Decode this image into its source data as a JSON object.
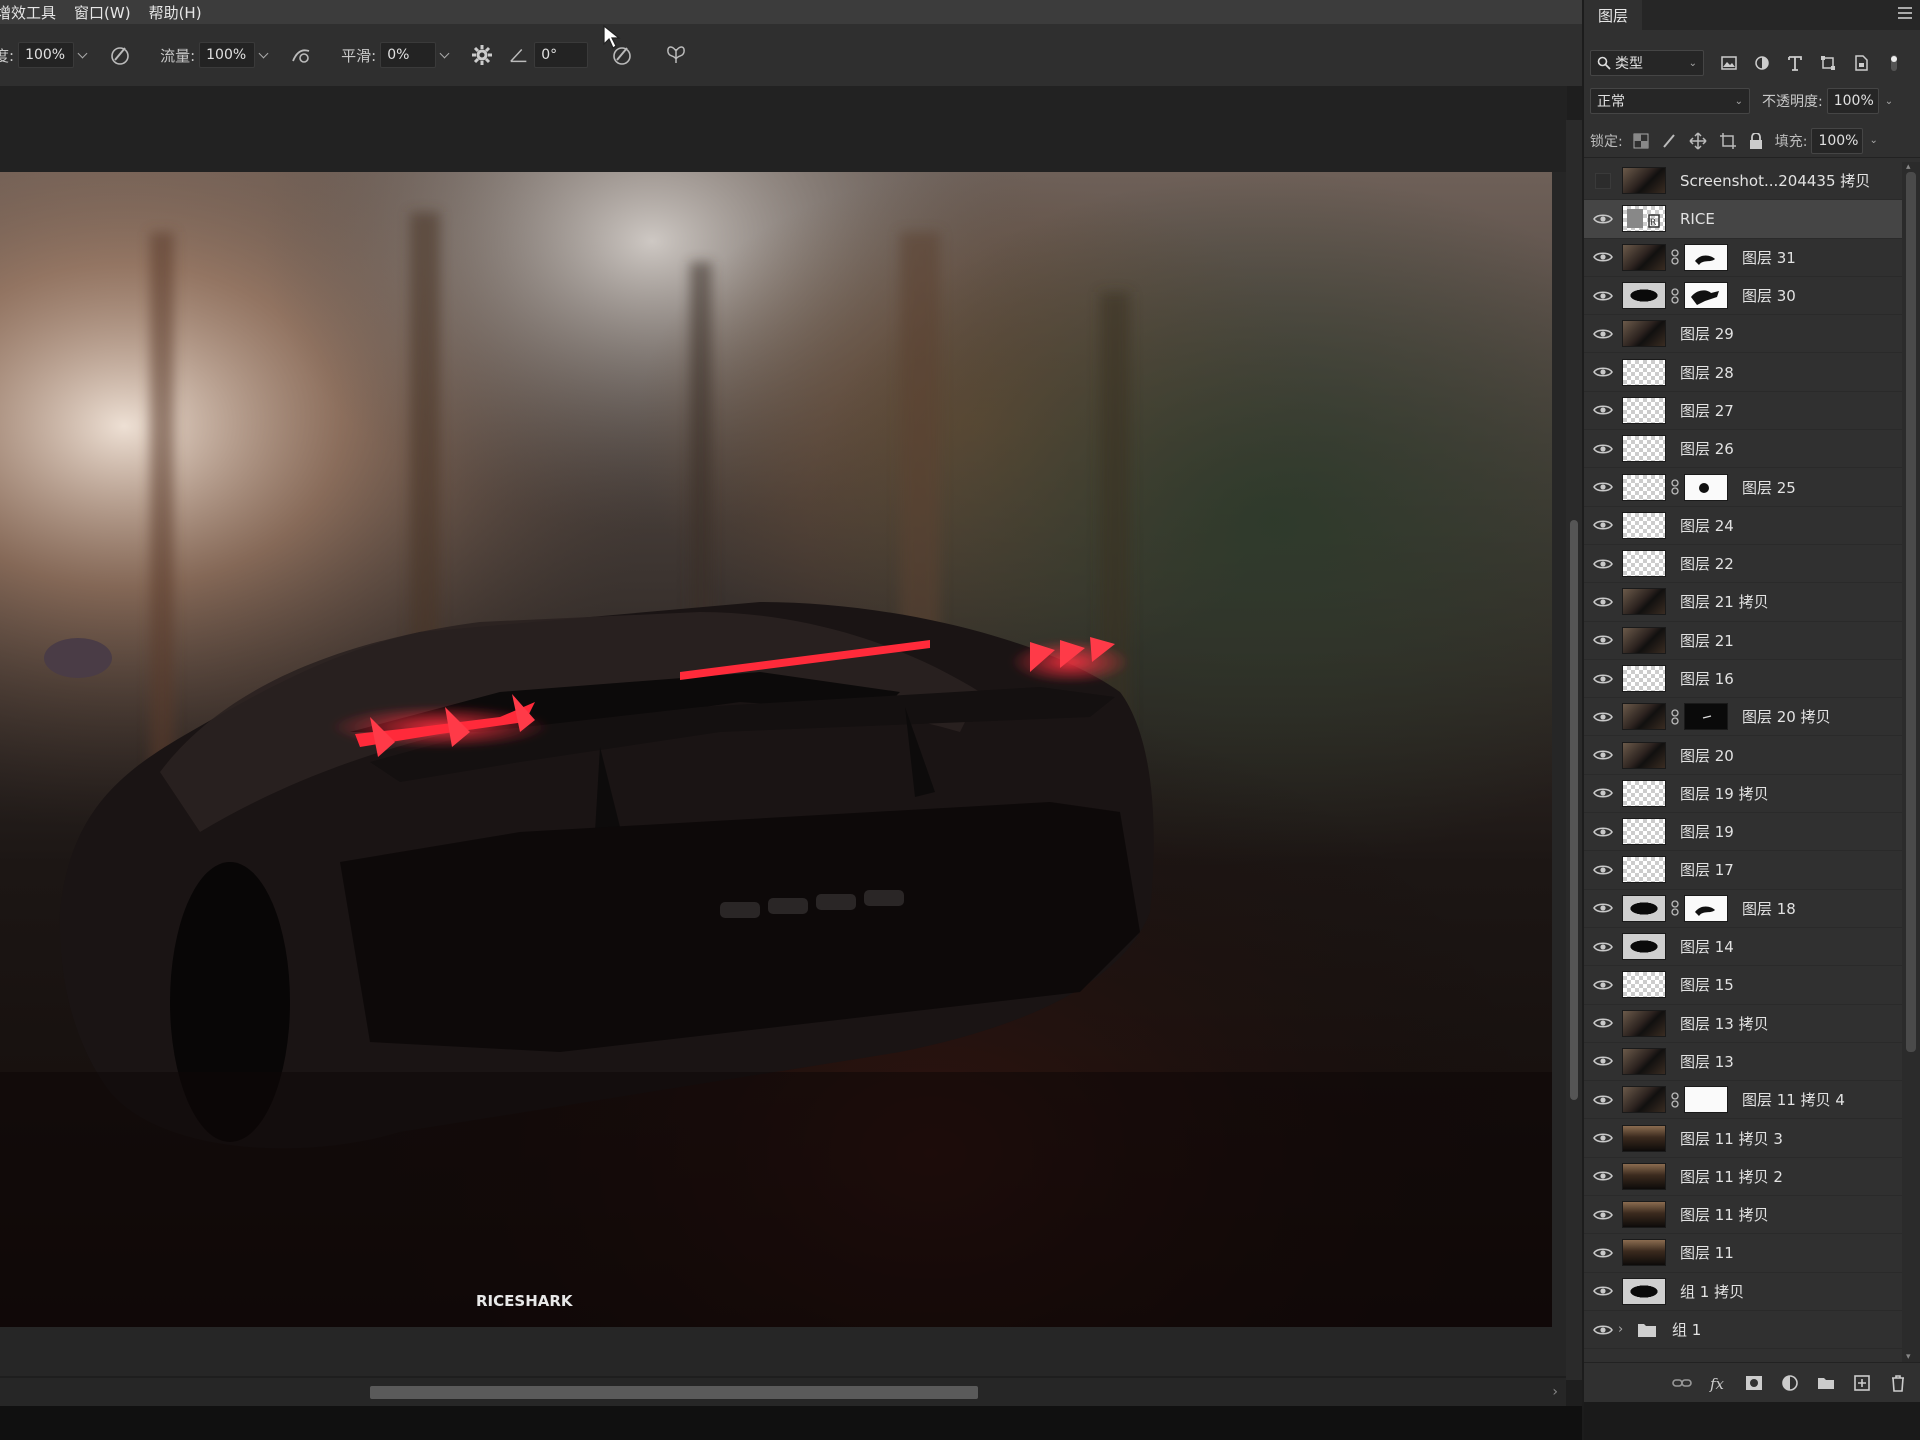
{
  "menubar": {
    "items": [
      "增效工具",
      "窗口(W)",
      "帮助(H)"
    ]
  },
  "options": {
    "opacity_label": "度:",
    "opacity_value": "100%",
    "flow_label": "流量:",
    "flow_value": "100%",
    "smoothing_label": "平滑:",
    "smoothing_value": "0%",
    "angle_value": "0°"
  },
  "canvas": {
    "watermark": "RICESHARK"
  },
  "layers_panel": {
    "tab_title": "图层",
    "filter_kind": "类型",
    "blend_mode": "正常",
    "opacity_label": "不透明度:",
    "opacity_value": "100%",
    "lock_label": "锁定:",
    "fill_label": "填充:",
    "fill_value": "100%",
    "layers": [
      {
        "name": "Screenshot...204435 拷贝",
        "visible": false,
        "thumb": "photo",
        "mask": null,
        "selected": false
      },
      {
        "name": "RICE",
        "visible": true,
        "thumb": "smart",
        "mask": null,
        "selected": true
      },
      {
        "name": "图层 31",
        "visible": true,
        "thumb": "photo",
        "mask": "white-shape",
        "selected": false
      },
      {
        "name": "图层 30",
        "visible": true,
        "thumb": "car",
        "mask": "white-dark",
        "selected": false
      },
      {
        "name": "图层 29",
        "visible": true,
        "thumb": "photo",
        "mask": null,
        "selected": false
      },
      {
        "name": "图层 28",
        "visible": true,
        "thumb": "check",
        "mask": null,
        "selected": false
      },
      {
        "name": "图层 27",
        "visible": true,
        "thumb": "check",
        "mask": null,
        "selected": false
      },
      {
        "name": "图层 26",
        "visible": true,
        "thumb": "check",
        "mask": null,
        "selected": false
      },
      {
        "name": "图层 25",
        "visible": true,
        "thumb": "check",
        "mask": "white-dot",
        "selected": false
      },
      {
        "name": "图层 24",
        "visible": true,
        "thumb": "check",
        "mask": null,
        "selected": false
      },
      {
        "name": "图层 22",
        "visible": true,
        "thumb": "check",
        "mask": null,
        "selected": false
      },
      {
        "name": "图层 21 拷贝",
        "visible": true,
        "thumb": "photo",
        "mask": null,
        "selected": false
      },
      {
        "name": "图层 21",
        "visible": true,
        "thumb": "photo",
        "mask": null,
        "selected": false
      },
      {
        "name": "图层 16",
        "visible": true,
        "thumb": "check",
        "mask": null,
        "selected": false
      },
      {
        "name": "图层 20 拷贝",
        "visible": true,
        "thumb": "photo",
        "mask": "black",
        "selected": false
      },
      {
        "name": "图层 20",
        "visible": true,
        "thumb": "photo",
        "mask": null,
        "selected": false
      },
      {
        "name": "图层 19 拷贝",
        "visible": true,
        "thumb": "check",
        "mask": null,
        "selected": false
      },
      {
        "name": "图层 19",
        "visible": true,
        "thumb": "check",
        "mask": null,
        "selected": false
      },
      {
        "name": "图层 17",
        "visible": true,
        "thumb": "check",
        "mask": null,
        "selected": false
      },
      {
        "name": "图层 18",
        "visible": true,
        "thumb": "car",
        "mask": "white-shape",
        "selected": false
      },
      {
        "name": "图层 14",
        "visible": true,
        "thumb": "car",
        "mask": null,
        "selected": false
      },
      {
        "name": "图层 15",
        "visible": true,
        "thumb": "check",
        "mask": null,
        "selected": false
      },
      {
        "name": "图层 13 拷贝",
        "visible": true,
        "thumb": "photo",
        "mask": null,
        "selected": false
      },
      {
        "name": "图层 13",
        "visible": true,
        "thumb": "photo",
        "mask": null,
        "selected": false
      },
      {
        "name": "图层 11 拷贝 4",
        "visible": true,
        "thumb": "photo",
        "mask": "white",
        "selected": false
      },
      {
        "name": "图层 11 拷贝 3",
        "visible": true,
        "thumb": "photo2",
        "mask": null,
        "selected": false
      },
      {
        "name": "图层 11 拷贝 2",
        "visible": true,
        "thumb": "photo2",
        "mask": null,
        "selected": false
      },
      {
        "name": "图层 11 拷贝",
        "visible": true,
        "thumb": "photo2",
        "mask": null,
        "selected": false
      },
      {
        "name": "图层 11",
        "visible": true,
        "thumb": "photo2",
        "mask": null,
        "selected": false
      },
      {
        "name": "组 1 拷贝",
        "visible": true,
        "thumb": "car",
        "mask": null,
        "selected": false
      },
      {
        "name": "组 1",
        "visible": true,
        "thumb": "folder",
        "mask": null,
        "selected": false
      }
    ]
  },
  "colors": {
    "accent_taillight": "#ff2a3a",
    "panel_bg": "#303030",
    "selected_row": "#454545"
  }
}
